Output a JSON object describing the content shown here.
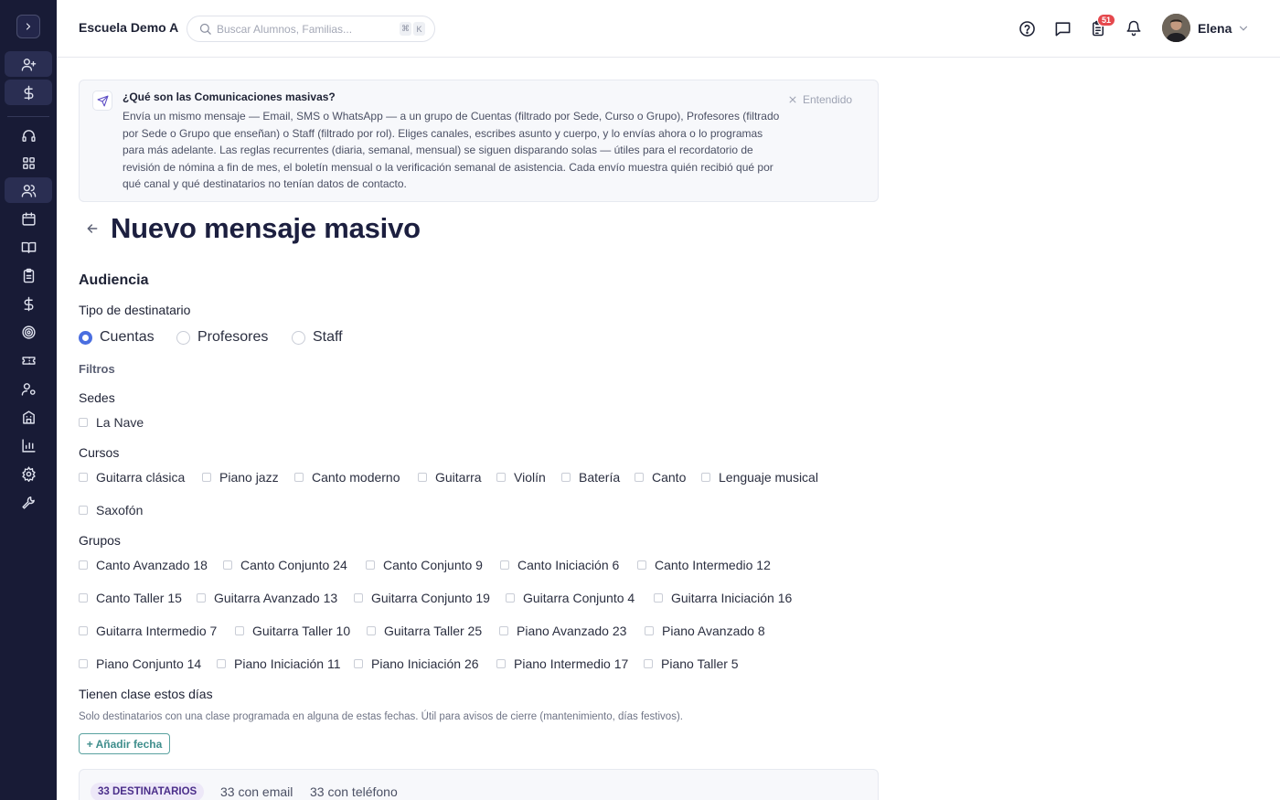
{
  "header": {
    "school_name": "Escuela Demo A",
    "search_placeholder": "Buscar Alumnos, Familias...",
    "kbd_cmd": "⌘",
    "kbd_key": "K",
    "tasks_badge": "51",
    "user_name": "Elena"
  },
  "banner": {
    "title": "¿Qué son las Comunicaciones masivas?",
    "text": "Envía un mismo mensaje — Email, SMS o WhatsApp — a un grupo de Cuentas (filtrado por Sede, Curso o Grupo), Profesores (filtrado por Sede o Grupo que enseñan) o Staff (filtrado por rol). Eliges canales, escribes asunto y cuerpo, y lo envías ahora o lo programas para más adelante. Las reglas recurrentes (diaria, semanal, mensual) se siguen disparando solas — útiles para el recordatorio de revisión de nómina a fin de mes, el boletín mensual o la verificación semanal de asistencia. Cada envío muestra quién recibió qué por qué canal y qué destinatarios no tenían datos de contacto.",
    "dismiss": "Entendido"
  },
  "page": {
    "title": "Nuevo mensaje masivo"
  },
  "audience": {
    "section_title": "Audiencia",
    "recipient_type_label": "Tipo de destinatario",
    "recipient_types": [
      "Cuentas",
      "Profesores",
      "Staff"
    ],
    "selected_type": "Cuentas",
    "filters_label": "Filtros",
    "sedes_label": "Sedes",
    "sedes": [
      "La Nave"
    ],
    "cursos_label": "Cursos",
    "cursos": [
      "Guitarra clásica",
      "Piano jazz",
      "Canto moderno",
      "Guitarra",
      "Violín",
      "Batería",
      "Canto",
      "Lenguaje musical",
      "Saxofón"
    ],
    "grupos_label": "Grupos",
    "grupos": [
      "Canto Avanzado 18",
      "Canto Conjunto 24",
      "Canto Conjunto 9",
      "Canto Iniciación 6",
      "Canto Intermedio 12",
      "Canto Taller 15",
      "Guitarra Avanzado 13",
      "Guitarra Conjunto 19",
      "Guitarra Conjunto 4",
      "Guitarra Iniciación 16",
      "Guitarra Intermedio 7",
      "Guitarra Taller 10",
      "Guitarra Taller 25",
      "Piano Avanzado 23",
      "Piano Avanzado 8",
      "Piano Conjunto 14",
      "Piano Iniciación 11",
      "Piano Iniciación 26",
      "Piano Intermedio 17",
      "Piano Taller 5"
    ],
    "days_label": "Tienen clase estos días",
    "days_hint": "Solo destinatarios con una clase programada en alguna de estas fechas. Útil para avisos de cierre (mantenimiento, días festivos).",
    "add_date": "+ Añadir fecha"
  },
  "summary": {
    "recipients": "33 DESTINATARIOS",
    "with_email": "33 con email",
    "with_phone": "33 con teléfono"
  }
}
